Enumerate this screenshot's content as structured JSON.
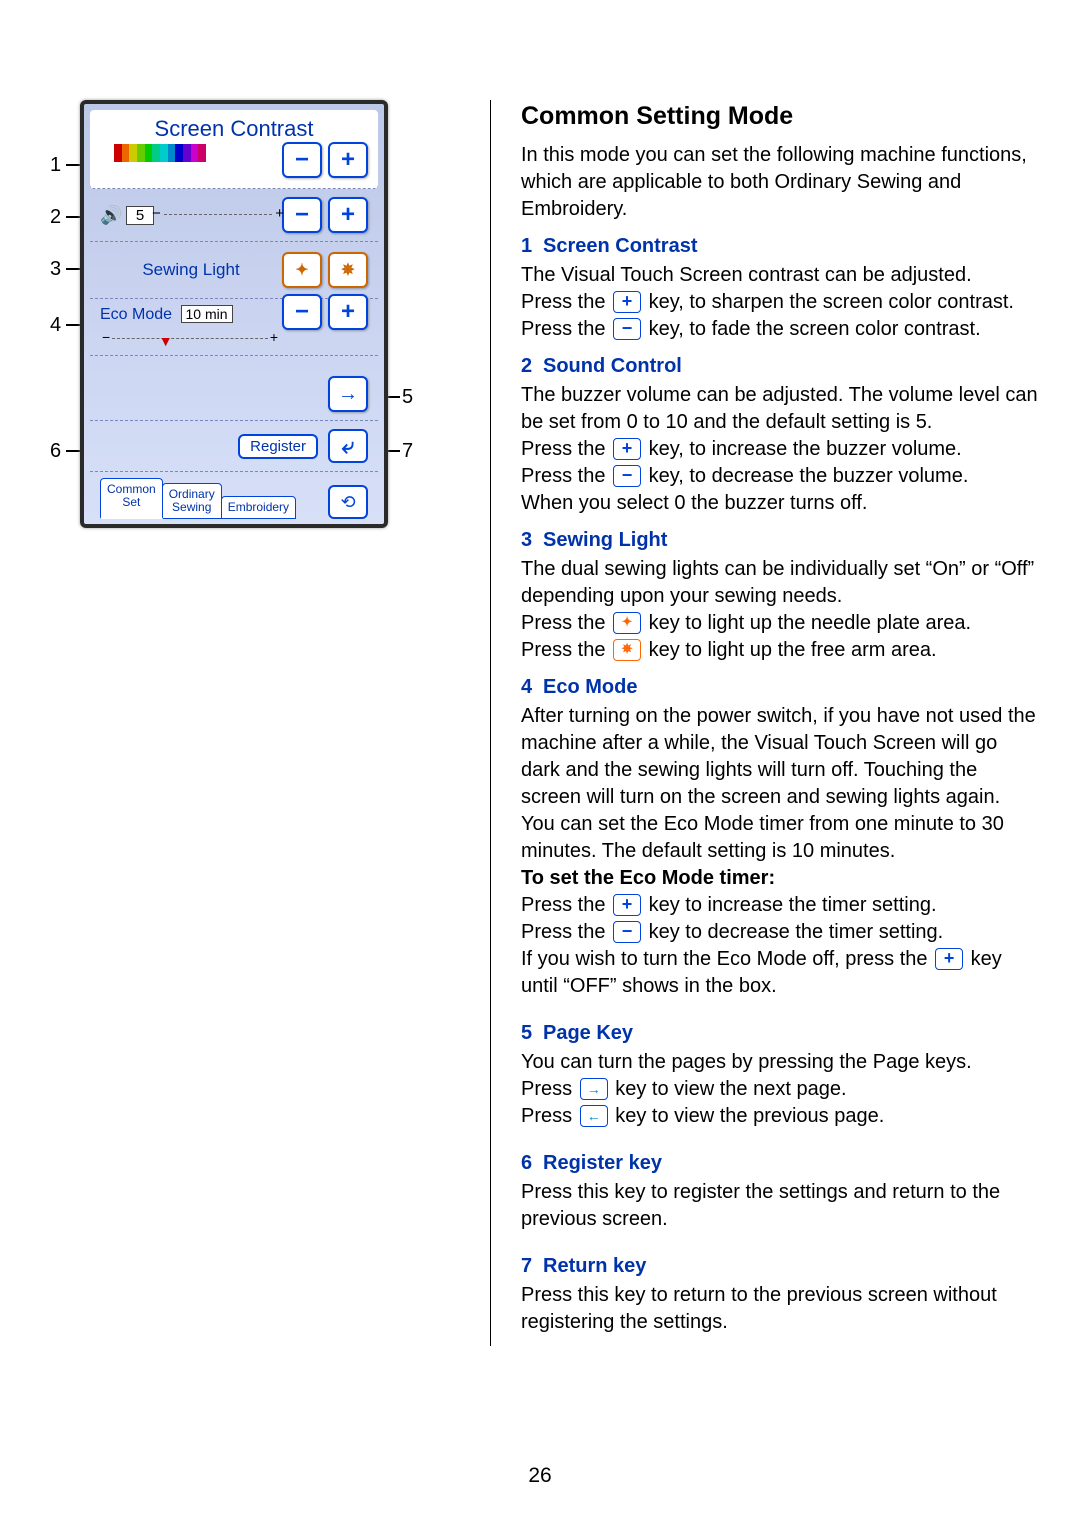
{
  "page_number": "26",
  "screenshot": {
    "title": "Screen Contrast",
    "sound_value": "5",
    "sewing_light_label": "Sewing Light",
    "eco_mode_label": "Eco Mode",
    "eco_mode_value": "10 min",
    "register_label": "Register",
    "tabs": {
      "common_set": "Common\nSet",
      "ordinary_sewing": "Ordinary\nSewing",
      "embroidery": "Embroidery"
    }
  },
  "callouts": {
    "c1": "1",
    "c2": "2",
    "c3": "3",
    "c4": "4",
    "c5": "5",
    "c6": "6",
    "c7": "7"
  },
  "heading": "Common Setting Mode",
  "intro": "In this mode you can set the following machine functions, which are applicable to both Ordinary Sewing and Embroidery.",
  "sections": {
    "s1": {
      "num": "1",
      "title": "Screen Contrast",
      "p1": "The Visual Touch Screen contrast can be adjusted.",
      "p2a": "Press the ",
      "p2b": " key, to sharpen the screen color contrast.",
      "p3a": "Press the ",
      "p3b": " key, to fade the screen color contrast."
    },
    "s2": {
      "num": "2",
      "title": "Sound Control",
      "p1": "The buzzer volume can be adjusted. The volume level can be set from 0 to 10 and the default setting is 5.",
      "p2a": "Press the ",
      "p2b": " key, to increase the buzzer volume.",
      "p3a": "Press the ",
      "p3b": " key, to decrease the buzzer volume.",
      "p4": "When you select 0 the buzzer turns off."
    },
    "s3": {
      "num": "3",
      "title": "Sewing Light",
      "p1": "The dual sewing lights can be individually set “On” or “Off” depending upon your sewing needs.",
      "p2a": "Press the ",
      "p2b": " key to light up the needle plate area.",
      "p3a": "Press the ",
      "p3b": " key to light up the free arm area."
    },
    "s4": {
      "num": "4",
      "title": "Eco Mode",
      "p1": "After turning on the power switch, if you have not used the machine after a while, the Visual Touch Screen will go dark and the sewing lights will turn off. Touching the screen will turn on the screen and sewing lights again.",
      "p2": "You can set the Eco Mode timer from one minute to 30 minutes. The default setting is 10 minutes.",
      "subhead": "To set the Eco Mode timer:",
      "p3a": "Press the ",
      "p3b": " key to increase the timer setting.",
      "p4a": "Press the ",
      "p4b": " key to decrease the timer setting.",
      "p5a": "If you wish to turn the Eco Mode off, press the ",
      "p5b": " key until “OFF” shows in the box."
    },
    "s5": {
      "num": "5",
      "title": "Page Key",
      "p1": "You can turn the pages by pressing the Page keys.",
      "p2a": "Press ",
      "p2b": " key to view the next page.",
      "p3a": "Press ",
      "p3b": " key to view the previous page."
    },
    "s6": {
      "num": "6",
      "title": "Register key",
      "p1": "Press this key to register the settings and return to the previous screen."
    },
    "s7": {
      "num": "7",
      "title": "Return key",
      "p1": "Press this key to return to the previous screen without registering the settings."
    }
  }
}
